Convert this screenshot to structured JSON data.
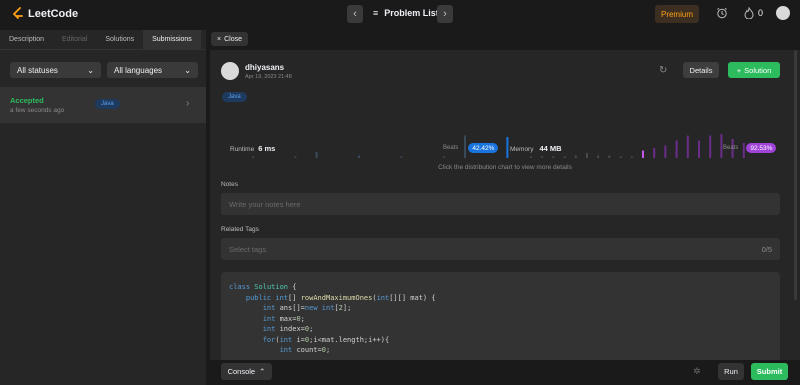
{
  "topbar": {
    "logo_text": "LeetCode",
    "problem_list_label": "Problem List",
    "premium_label": "Premium",
    "streak_count": "0",
    "prev_icon": "chevron-left-icon",
    "next_icon": "chevron-right-icon"
  },
  "left": {
    "tabs": [
      {
        "label": "Description"
      },
      {
        "label": "Editorial"
      },
      {
        "label": "Solutions"
      },
      {
        "label": "Submissions"
      }
    ],
    "filters": {
      "status": "All statuses",
      "language": "All languages"
    },
    "submission": {
      "status": "Accepted",
      "time_ago": "a few seconds ago",
      "language": "Java"
    }
  },
  "right": {
    "close_label": "Close",
    "user": {
      "name": "dhiyasans",
      "date": "Apr 19, 2023 21:48"
    },
    "details_label": "Details",
    "solution_label": "Solution",
    "language_badge": "Java",
    "runtime": {
      "label": "Runtime",
      "value": "6 ms",
      "beats_label": "Beats",
      "beats_pct": "42.42%"
    },
    "memory": {
      "label": "Memory",
      "value": "44 MB",
      "beats_label": "Beats",
      "beats_pct": "92.53%"
    },
    "hint": "Click the distribution chart to view more details",
    "notes": {
      "label": "Notes",
      "placeholder": "Write your notes here"
    },
    "tags": {
      "label": "Related Tags",
      "placeholder": "Select tags",
      "count": "0/5"
    },
    "code_lines": [
      "class Solution {",
      "    public int[] rowAndMaximumOnes(int[][] mat) {",
      "        int ans[]=new int[2];",
      "        int max=0;",
      "        int index=0;",
      "        for(int i=0;i<mat.length;i++){",
      "            int count=0;"
    ],
    "console_label": "Console",
    "run_label": "Run",
    "submit_label": "Submit"
  },
  "colors": {
    "accent_green": "#2cbb5d",
    "premium_orange": "#ffa116",
    "runtime_blue": "#1a74e0",
    "memory_purple": "#a142d9"
  },
  "chart_data": {
    "type": "bar",
    "runtime_distribution": [
      0.03,
      0,
      0.03,
      0.12,
      0,
      0.05,
      0,
      0.03,
      0,
      0.03,
      0.45,
      0,
      0.42
    ],
    "runtime_highlight_index": 12,
    "memory_distribution": [
      0.03,
      0.03,
      0.03,
      0.03,
      0.05,
      0.1,
      0.05,
      0.05,
      0.03,
      0.03,
      0.15,
      0.2,
      0.25,
      0.35,
      0.45,
      0.35,
      0.45,
      0.48,
      0.38,
      0.3
    ],
    "memory_highlight_index": 10
  }
}
